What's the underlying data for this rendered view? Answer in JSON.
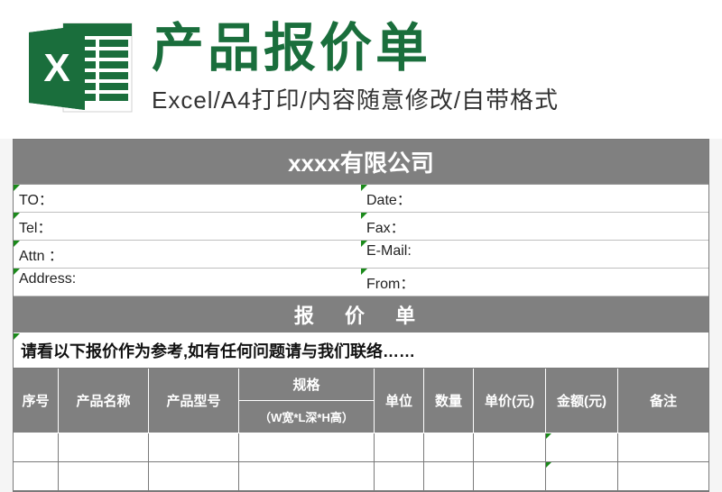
{
  "banner": {
    "title": "产品报价单",
    "subtitle": "Excel/A4打印/内容随意修改/自带格式",
    "icon_label": "X"
  },
  "sheet": {
    "company": "xxxx有限公司",
    "info": {
      "to": "TO：",
      "date": "Date：",
      "tel": "Tel：",
      "fax": "Fax：",
      "attn": "Attn ：",
      "email": "E-Mail:",
      "address": "Address:",
      "from": "From："
    },
    "quote_title": "报  价  单",
    "note": "请看以下报价作为参考,如有任何问题请与我们联络……",
    "columns": {
      "seq": "序号",
      "name": "产品名称",
      "model": "产品型号",
      "spec": "规格",
      "spec_sub": "（W宽*L深*H高）",
      "unit": "单位",
      "qty": "数量",
      "price": "单价(元)",
      "amount": "金额(元)",
      "remark": "备注"
    }
  }
}
